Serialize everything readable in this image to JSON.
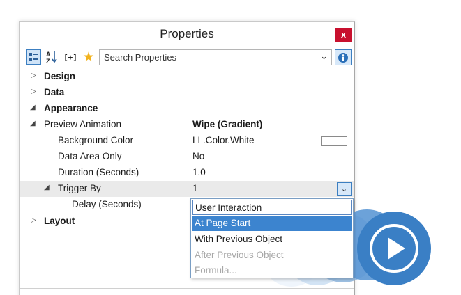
{
  "window": {
    "title": "Properties",
    "close_label": "x"
  },
  "toolbar": {
    "search_placeholder": "Search Properties",
    "expand_label": "[+]",
    "icons": [
      "categorized-icon",
      "sort-alpha-icon",
      "expand-all-icon",
      "star-icon",
      "chevron-down-icon",
      "info-icon"
    ]
  },
  "properties": {
    "design": "Design",
    "data": "Data",
    "appearance": "Appearance",
    "preview_animation": {
      "label": "Preview Animation",
      "value": "Wipe (Gradient)"
    },
    "background_color": {
      "label": "Background Color",
      "value": "LL.Color.White"
    },
    "data_area_only": {
      "label": "Data Area Only",
      "value": "No"
    },
    "duration": {
      "label": "Duration (Seconds)",
      "value": "1.0"
    },
    "trigger_by": {
      "label": "Trigger By",
      "value": "1"
    },
    "delay": {
      "label": "Delay (Seconds)"
    },
    "layout": "Layout"
  },
  "dropdown": {
    "options": [
      "User Interaction",
      "At Page Start",
      "With Previous Object",
      "After Previous Object",
      "Formula..."
    ],
    "selected": "At Page Start"
  },
  "colors": {
    "accent": "#3c84cf",
    "close": "#c8102e",
    "play_circle": "#3a7fc5"
  }
}
